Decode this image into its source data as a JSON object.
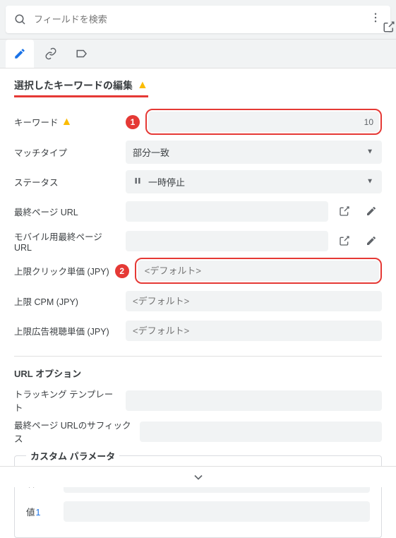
{
  "search": {
    "placeholder": "フィールドを検索"
  },
  "section_title": "選択したキーワードの編集",
  "fields": {
    "keyword": {
      "label": "キーワード",
      "value": "",
      "counter": "10"
    },
    "match_type": {
      "label": "マッチタイプ",
      "value": "部分一致"
    },
    "status": {
      "label": "ステータス",
      "value": "一時停止"
    },
    "final_url": {
      "label": "最終ページ URL",
      "value": ""
    },
    "mobile_final_url": {
      "label": "モバイル用最終ページ URL",
      "value": ""
    },
    "max_cpc": {
      "label": "上限クリック単価 (JPY)",
      "placeholder": "<デフォルト>"
    },
    "max_cpm": {
      "label": "上限 CPM (JPY)",
      "placeholder": "<デフォルト>"
    },
    "max_cpv": {
      "label": "上限広告視聴単価 (JPY)",
      "placeholder": "<デフォルト>"
    }
  },
  "url_options": {
    "title": "URL オプション",
    "tracking_template": {
      "label": "トラッキング テンプレート",
      "value": ""
    },
    "final_url_suffix": {
      "label": "最終ページ URLのサフィックス",
      "value": ""
    }
  },
  "custom_params": {
    "title": "カスタム パラメータ",
    "name_label": "名前",
    "value_label": "値",
    "index": "1"
  },
  "annotations": {
    "badge1": "1",
    "badge2": "2"
  }
}
